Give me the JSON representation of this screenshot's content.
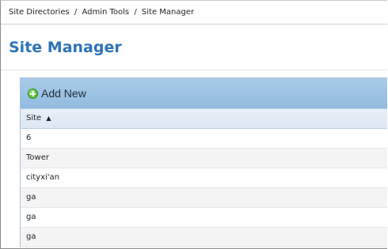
{
  "breadcrumb": {
    "items": [
      "Site Directories",
      "Admin Tools",
      "Site Manager"
    ],
    "separator": "/"
  },
  "page": {
    "title": "Site Manager"
  },
  "toolbar": {
    "add_new_label": "Add New",
    "add_icon": "plus-circle-icon"
  },
  "table": {
    "column_header": "Site",
    "sort_indicator": "▲",
    "rows": [
      "6",
      "Tower",
      "cityxi'an",
      "ga",
      "ga",
      "ga"
    ]
  },
  "colors": {
    "title": "#2c73b6",
    "toolbar": "#a8cbe8",
    "header": "#e8f0f8"
  }
}
